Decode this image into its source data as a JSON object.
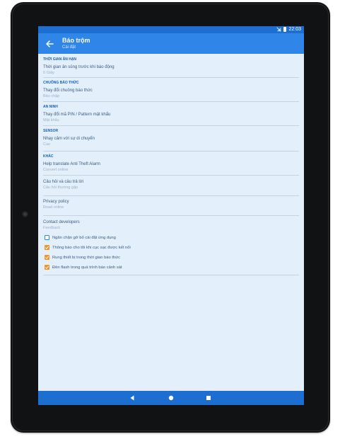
{
  "status_bar": {
    "time": "22:03"
  },
  "app_bar": {
    "title": "Báo trộm",
    "subtitle": "Cài đặt"
  },
  "sections": {
    "time": {
      "category": "Thời gian ân hạn",
      "item_title": "Thời gian ân sủng trước khi báo động",
      "item_sub": "0 Giây"
    },
    "bell": {
      "category": "Chuông báo thức",
      "item_title": "Thay đổi chuông báo thức",
      "item_sub": "Báo chập"
    },
    "security": {
      "category": "An ninh",
      "item_title": "Thay đổi mã PIN / Pattern mật khẩu",
      "item_sub": "Mật khẩu"
    },
    "sensor": {
      "category": "Sensor",
      "item_title": "Nhạy cảm với sự di chuyển",
      "item_sub": "Cao"
    },
    "other": {
      "category": "Khác",
      "items": [
        {
          "title": "Help translate Anti Theft Alarm",
          "sub": "Convert online"
        },
        {
          "title": "Câu hỏi và câu trả lời",
          "sub": "Câu hỏi thường gặp"
        },
        {
          "title": "Privacy policy",
          "sub": "Read online"
        },
        {
          "title": "Contact developers",
          "sub": "Feedback"
        }
      ]
    }
  },
  "checkboxes": [
    {
      "label": "Ngăn chặn gỡ bỏ cài đặt ứng dụng",
      "checked": false
    },
    {
      "label": "Thông báo cho tôi khi cục sạc được kết nối",
      "checked": true
    },
    {
      "label": "Rung thiết bị trong thời gian báo thức",
      "checked": true
    },
    {
      "label": "Đèn flash trong quá trình báo cảnh sát",
      "checked": true
    }
  ],
  "colors": {
    "accent": "#2f86e8",
    "status_bar": "#1c6fd0",
    "checkbox_checked": "#f0932b",
    "background": "#e3f0fc"
  }
}
